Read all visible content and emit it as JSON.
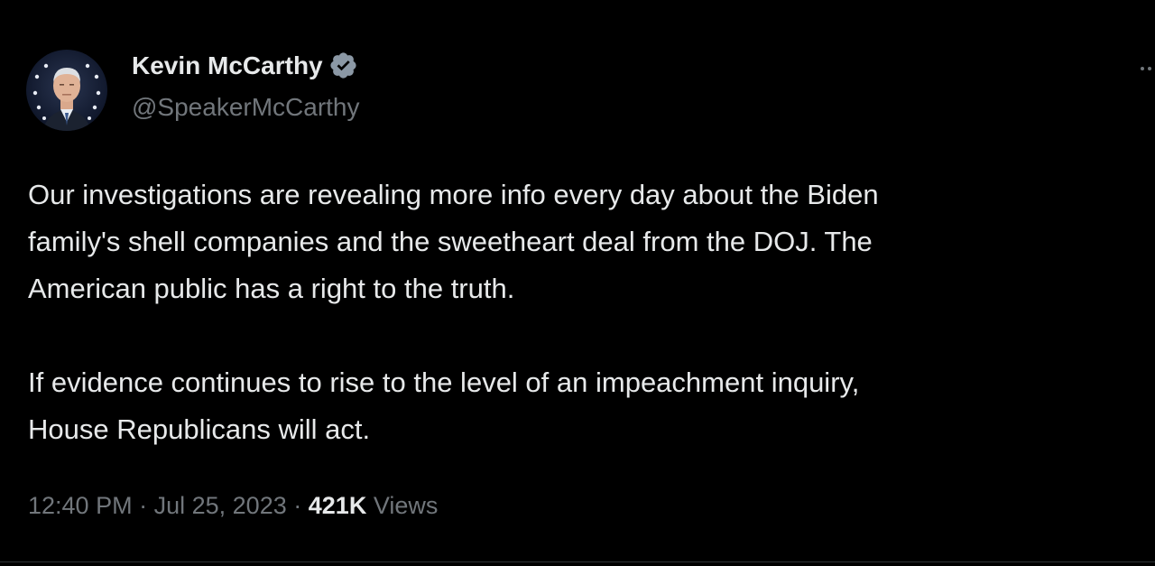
{
  "tweet": {
    "author": {
      "name": "Kevin McCarthy",
      "handle": "@SpeakerMcCarthy",
      "verified": true,
      "verified_color": "#8b98a5",
      "avatar_icon": "profile-photo"
    },
    "body": {
      "paragraph_1": "Our investigations are revealing more info every day about the Biden\nfamily's shell companies and the sweetheart deal from the DOJ. The\nAmerican public has a right to the truth.",
      "paragraph_2": "If evidence continues to rise to the level of an impeachment inquiry,\nHouse Republicans will act."
    },
    "meta": {
      "time": "12:40 PM",
      "separator": "·",
      "date": "Jul 25, 2023",
      "views_count": "421K",
      "views_label": "Views"
    },
    "more_icon": "more-options-icon"
  },
  "colors": {
    "background": "#000000",
    "primary_text": "#e7e9ea",
    "secondary_text": "#71767b"
  }
}
